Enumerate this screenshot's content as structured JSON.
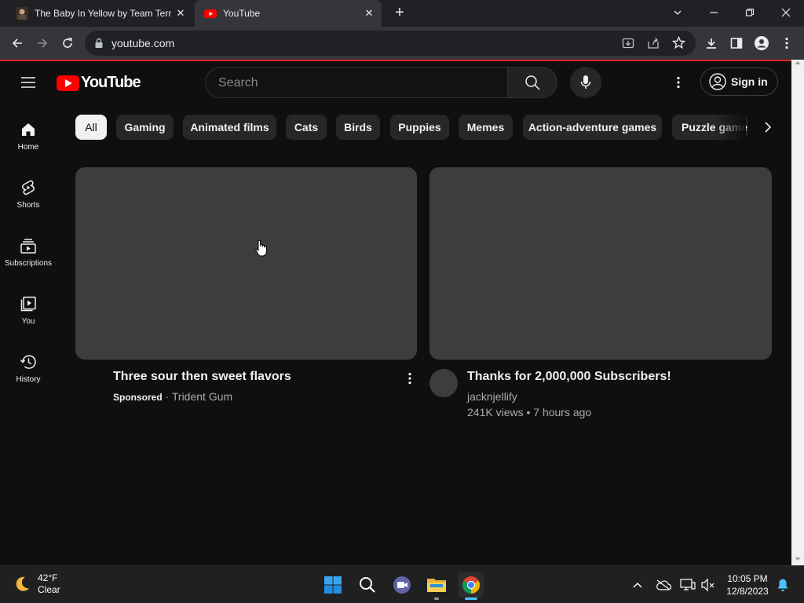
{
  "browser": {
    "tabs": [
      {
        "title": "The Baby In Yellow by Team Terrible",
        "active": false
      },
      {
        "title": "YouTube",
        "active": true
      }
    ],
    "address": "youtube.com"
  },
  "youtube": {
    "logo_text": "YouTube",
    "search_placeholder": "Search",
    "signin_label": "Sign in",
    "sidebar": [
      {
        "label": "Home",
        "icon": "home-icon"
      },
      {
        "label": "Shorts",
        "icon": "shorts-icon"
      },
      {
        "label": "Subscriptions",
        "icon": "subscriptions-icon"
      },
      {
        "label": "You",
        "icon": "you-icon"
      },
      {
        "label": "History",
        "icon": "history-icon"
      }
    ],
    "chips": [
      "All",
      "Gaming",
      "Animated films",
      "Cats",
      "Birds",
      "Puppies",
      "Memes",
      "Action-adventure games",
      "Puzzle games"
    ],
    "videos": [
      {
        "title": "Three sour then sweet flavors",
        "sponsored_label": "Sponsored",
        "channel": "Trident Gum"
      },
      {
        "title": "Thanks for 2,000,000 Subscribers!",
        "channel": "jacknjellify",
        "meta": "241K views • 7 hours ago"
      }
    ]
  },
  "taskbar": {
    "weather_temp": "42°F",
    "weather_desc": "Clear",
    "time": "10:05 PM",
    "date": "12/8/2023"
  },
  "colors": {
    "yt_bg": "#0f0f0f",
    "chip_bg": "#272727",
    "thumb_placeholder": "#3d3d3d",
    "yt_red": "#ff0000",
    "taskbar_bg": "#202020"
  }
}
